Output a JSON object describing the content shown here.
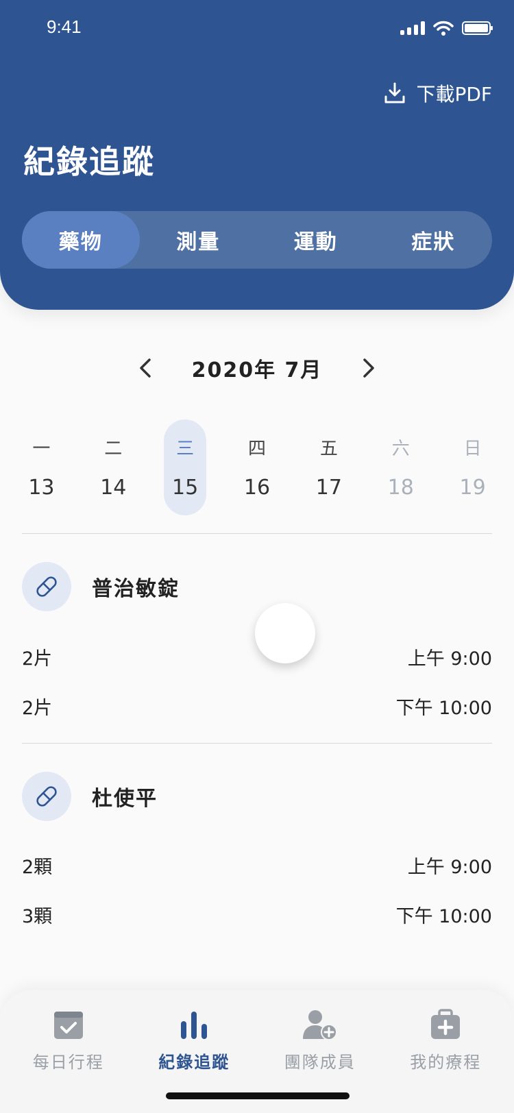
{
  "status": {
    "time": "9:41"
  },
  "header": {
    "download_label": "下載PDF",
    "title": "紀錄追蹤"
  },
  "segments": [
    {
      "label": "藥物",
      "active": true
    },
    {
      "label": "測量"
    },
    {
      "label": "運動"
    },
    {
      "label": "症狀"
    }
  ],
  "calendar": {
    "month_label": "2020年 7月",
    "days": [
      {
        "weekday": "一",
        "date": "13"
      },
      {
        "weekday": "二",
        "date": "14"
      },
      {
        "weekday": "三",
        "date": "15",
        "selected": true
      },
      {
        "weekday": "四",
        "date": "16"
      },
      {
        "weekday": "五",
        "date": "17"
      },
      {
        "weekday": "六",
        "date": "18",
        "muted": true
      },
      {
        "weekday": "日",
        "date": "19",
        "muted": true
      }
    ]
  },
  "medications": [
    {
      "name": "普治敏錠",
      "doses": [
        {
          "amount": "2片",
          "time": "上午 9:00"
        },
        {
          "amount": "2片",
          "time": "下午 10:00"
        }
      ]
    },
    {
      "name": "杜使平",
      "doses": [
        {
          "amount": "2顆",
          "time": "上午 9:00"
        },
        {
          "amount": "3顆",
          "time": "下午 10:00"
        }
      ]
    }
  ],
  "tabbar": [
    {
      "label": "每日行程",
      "icon": "calendar-check-icon"
    },
    {
      "label": "紀錄追蹤",
      "icon": "bar-chart-icon",
      "active": true
    },
    {
      "label": "團隊成員",
      "icon": "add-user-icon"
    },
    {
      "label": "我的療程",
      "icon": "medical-kit-icon"
    }
  ],
  "colors": {
    "primary": "#2e5591",
    "segment_active": "#5a80c2",
    "pill_bg": "#e2e8f4",
    "inactive": "#9a9fa6"
  }
}
